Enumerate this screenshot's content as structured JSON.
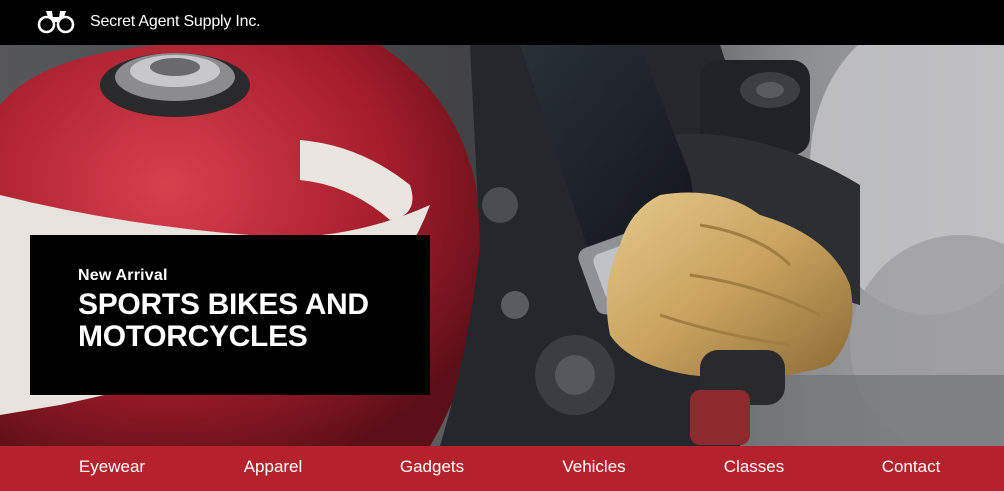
{
  "header": {
    "brand": "Secret Agent Supply Inc.",
    "logo_icon": "binoculars-icon",
    "background": "#000000"
  },
  "hero": {
    "image_icon": "motorcycle-photo",
    "promo": {
      "kicker": "New Arrival",
      "title": "SPORTS BIKES AND MOTORCYCLES"
    }
  },
  "nav": {
    "background": "#b6222c",
    "items": [
      {
        "label": "Eyewear"
      },
      {
        "label": "Apparel"
      },
      {
        "label": "Gadgets"
      },
      {
        "label": "Vehicles"
      },
      {
        "label": "Classes"
      },
      {
        "label": "Contact"
      }
    ]
  }
}
